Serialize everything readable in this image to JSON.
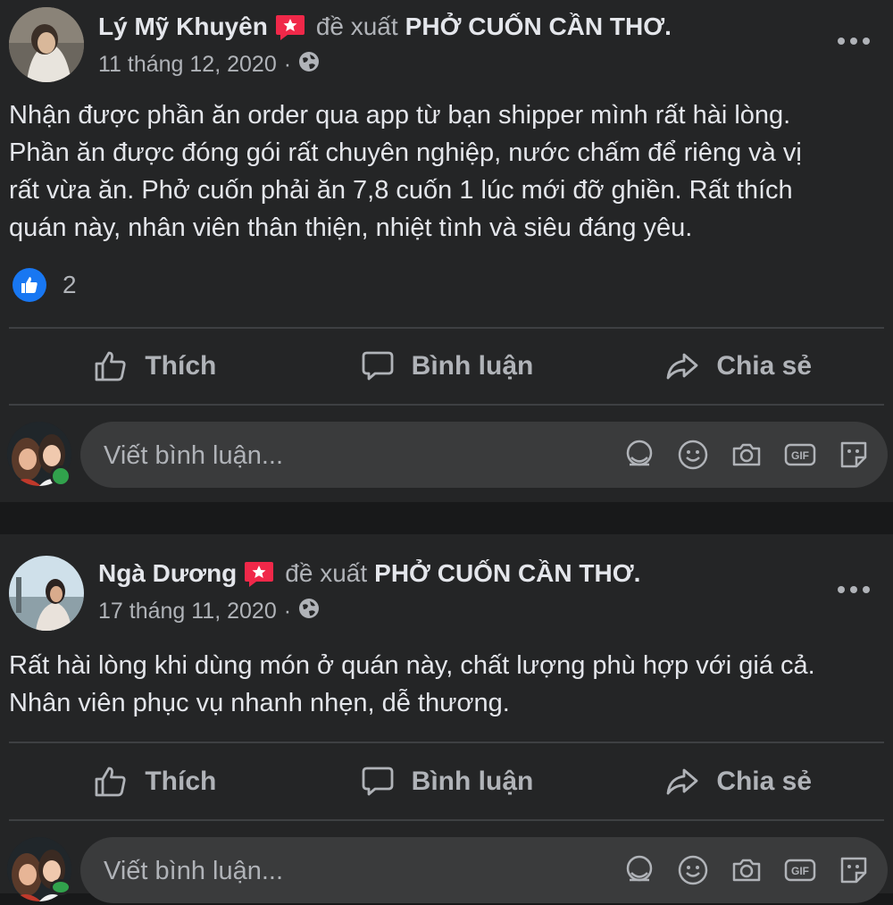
{
  "colors": {
    "background": "#242526",
    "page_background": "#18191a",
    "primary_text": "#e4e6eb",
    "secondary_text": "#b0b3b8",
    "like_blue": "#1877f2",
    "recommend_red": "#f02849",
    "online_green": "#31a24c"
  },
  "posts": [
    {
      "author": "Lý Mỹ Khuyên",
      "verb": "đề xuất",
      "page": "PHỞ CUỐN CẦN THƠ.",
      "date": "11 tháng 12, 2020",
      "separator": "·",
      "privacy_icon": "globe-icon",
      "body_lines": [
        "Nhận được phần ăn order qua app từ bạn shipper mình rất hài lòng.",
        "Phần ăn được đóng gói rất chuyên nghiệp, nước chấm để riêng và vị",
        "rất vừa ăn. Phở cuốn phải ăn 7,8 cuốn 1 lúc mới đỡ ghiền. Rất thích",
        "quán này, nhân viên thân thiện, nhiệt tình và siêu đáng yêu."
      ],
      "reaction_count": "2"
    },
    {
      "author": "Ngà Dương",
      "verb": "đề xuất",
      "page": "PHỞ CUỐN CẦN THƠ.",
      "date": "17 tháng 11, 2020",
      "separator": "·",
      "privacy_icon": "globe-icon",
      "body_lines": [
        "Rất hài lòng khi dùng món ở quán này, chất lượng phù hợp với giá cả.",
        "Nhân viên phục vụ nhanh nhẹn, dễ thương."
      ]
    }
  ],
  "actions": {
    "like": "Thích",
    "comment": "Bình luận",
    "share": "Chia sẻ"
  },
  "composer": {
    "placeholder": "Viết bình luận...",
    "tools": [
      "avatar-sticker-icon",
      "emoji-icon",
      "camera-icon",
      "gif-icon",
      "sticker-icon"
    ],
    "gif_label": "GIF"
  }
}
